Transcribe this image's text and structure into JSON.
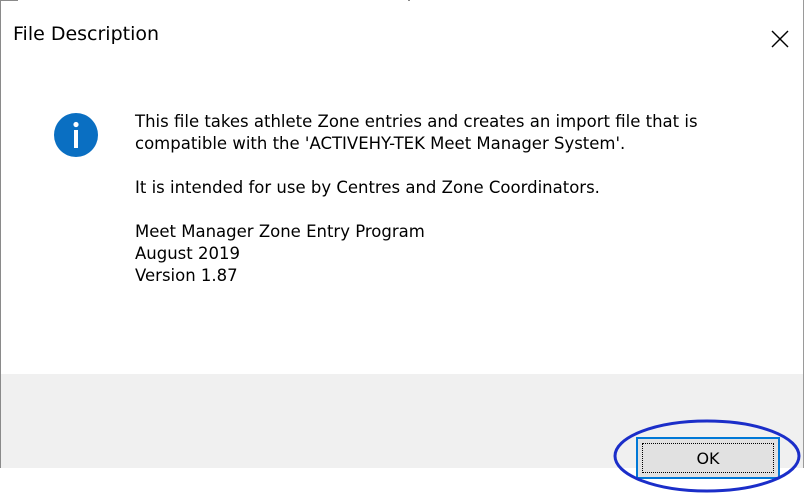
{
  "window": {
    "title": "File Description",
    "close_glyph": "✕"
  },
  "message": {
    "icon": "info-icon",
    "icon_color": "#0a6fc2",
    "paragraphs": [
      "This file takes athlete Zone entries and creates an import file that is compatible with the 'ACTIVEHY-TEK Meet Manager System'.",
      "It is intended for use by Centres and Zone Coordinators."
    ],
    "program_name": "Meet Manager Zone Entry Program",
    "release_date": "August 2019",
    "version": "Version 1.87"
  },
  "buttons": {
    "ok_label": "OK"
  },
  "annotation": {
    "highlight_color": "#1b2ec9",
    "target": "ok-button"
  }
}
